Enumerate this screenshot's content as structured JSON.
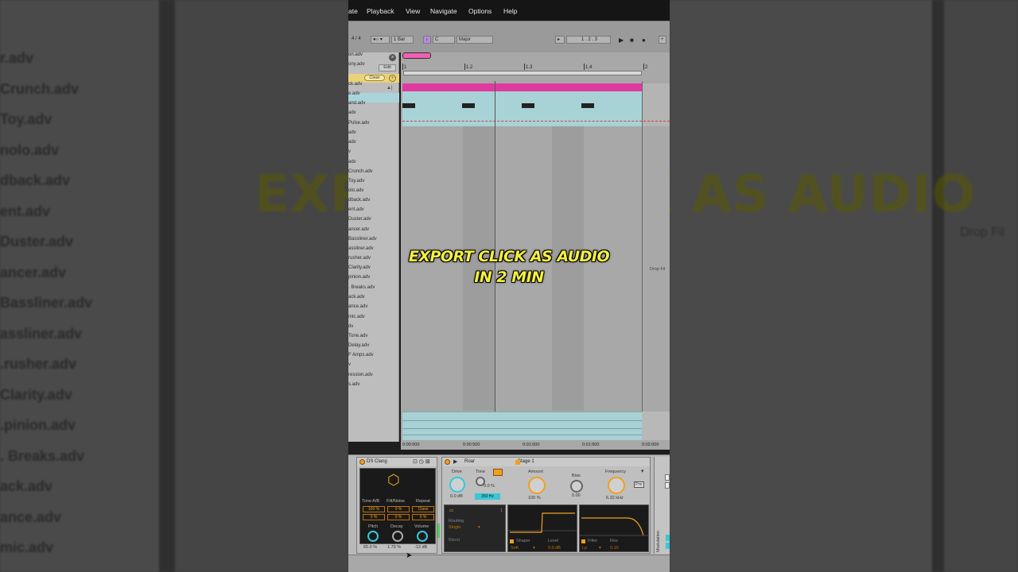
{
  "menu": [
    "ate",
    "Playback",
    "View",
    "Navigate",
    "Options",
    "Help"
  ],
  "toolbar": {
    "meter": "4 / 4",
    "quantize": "1 Bar",
    "key": "C",
    "scale": "Major",
    "position": "1 .  2 .  3"
  },
  "browser": {
    "edit_label": "Edit",
    "clear_label": "Clear",
    "files": [
      "on.adv",
      "ony.adv",
      "ck.adv",
      "e.adv",
      "and.adv",
      "adv",
      "Pulse.adv",
      "adv",
      "adv",
      "v",
      "adv",
      "Crunch.adv",
      "Toy.adv",
      "olo.adv",
      "dback.adv",
      "ent.adv",
      "Duster.adv",
      "ancer.adv",
      "Bassliner.adv",
      "assliner.adv",
      "rusher.adv",
      "Clarity.adv",
      "pinion.adv",
      ". Breaks.adv",
      "ack.adv",
      "ance.adv",
      "mic.adv",
      "dv",
      "Tone.adv",
      "Delay.adv",
      "F Amps.adv",
      "v",
      "ression.adv",
      "s.adv"
    ]
  },
  "arrangement": {
    "ruler": [
      "1",
      "1.2",
      "1.3",
      "1.4",
      "2"
    ],
    "times": [
      "0:00:000",
      "0:00:500",
      "0:01:000",
      "0:01:500",
      "0:02:000"
    ],
    "drop_hint": "Drop Fil"
  },
  "overlay": {
    "line1": "EXPORT CLICK AS AUDIO",
    "line2": "IN 2 MIN"
  },
  "background": {
    "title": "EXPORT CLICK AS AUDIO",
    "drop": "Drop Fil",
    "items": [
      "r.adv",
      "Crunch.adv",
      "Toy.adv",
      "nolo.adv",
      "dback.adv",
      "ent.adv",
      "Duster.adv",
      "ancer.adv",
      "Bassliner.adv",
      "assliner.adv",
      ".rusher.adv",
      "Clarity.adv",
      ".pinion.adv",
      ". Breaks.adv",
      "ack.adv",
      "ance.adv",
      "mic.adv"
    ]
  },
  "ds_clang": {
    "title": "DS Clang",
    "col_labels": [
      "Tone A/B",
      "Filt/Noise",
      "Repeat"
    ],
    "row1": [
      "100 %",
      "0 %",
      "Clave"
    ],
    "row2": [
      "0 %",
      "0 %",
      "0 %"
    ],
    "knob_labels": [
      "Pitch",
      "Decay",
      "Volume"
    ],
    "knob_values": [
      "65.0 %",
      "1.79 %",
      "-12 dB"
    ]
  },
  "roar": {
    "title": "Roar",
    "stage_title": "Stage 1",
    "drive_label": "Drive",
    "drive_value": "0.0 dB",
    "tone_label": "Tone",
    "tone_value": "0.0 %",
    "tone_freq": "350 Hz",
    "amount_label": "Amount",
    "amount_value": "100 %",
    "bias_label": "Bias",
    "bias_value": "0.00",
    "freq_label": "Frequency",
    "freq_value": "6.32 kHz",
    "pre_label": "Pre",
    "routing_label": "Routing",
    "routing_value": "Single",
    "blend_label": "Blend",
    "shaper_label": "Shaper",
    "shaper_value": "Soft",
    "level_label": "Level",
    "level_value": "0.0 dB",
    "filter_label": "Filter",
    "filter_value": "Lp",
    "res_label": "Res",
    "res_value": "0.10",
    "modulation_label": "Modulation"
  },
  "colors": {
    "clip": "#e03aa0",
    "clip_body": "#a7d3d6",
    "accent_orange": "#f0a020",
    "accent_teal": "#38c8d8",
    "overlay_text": "#f4f040"
  }
}
